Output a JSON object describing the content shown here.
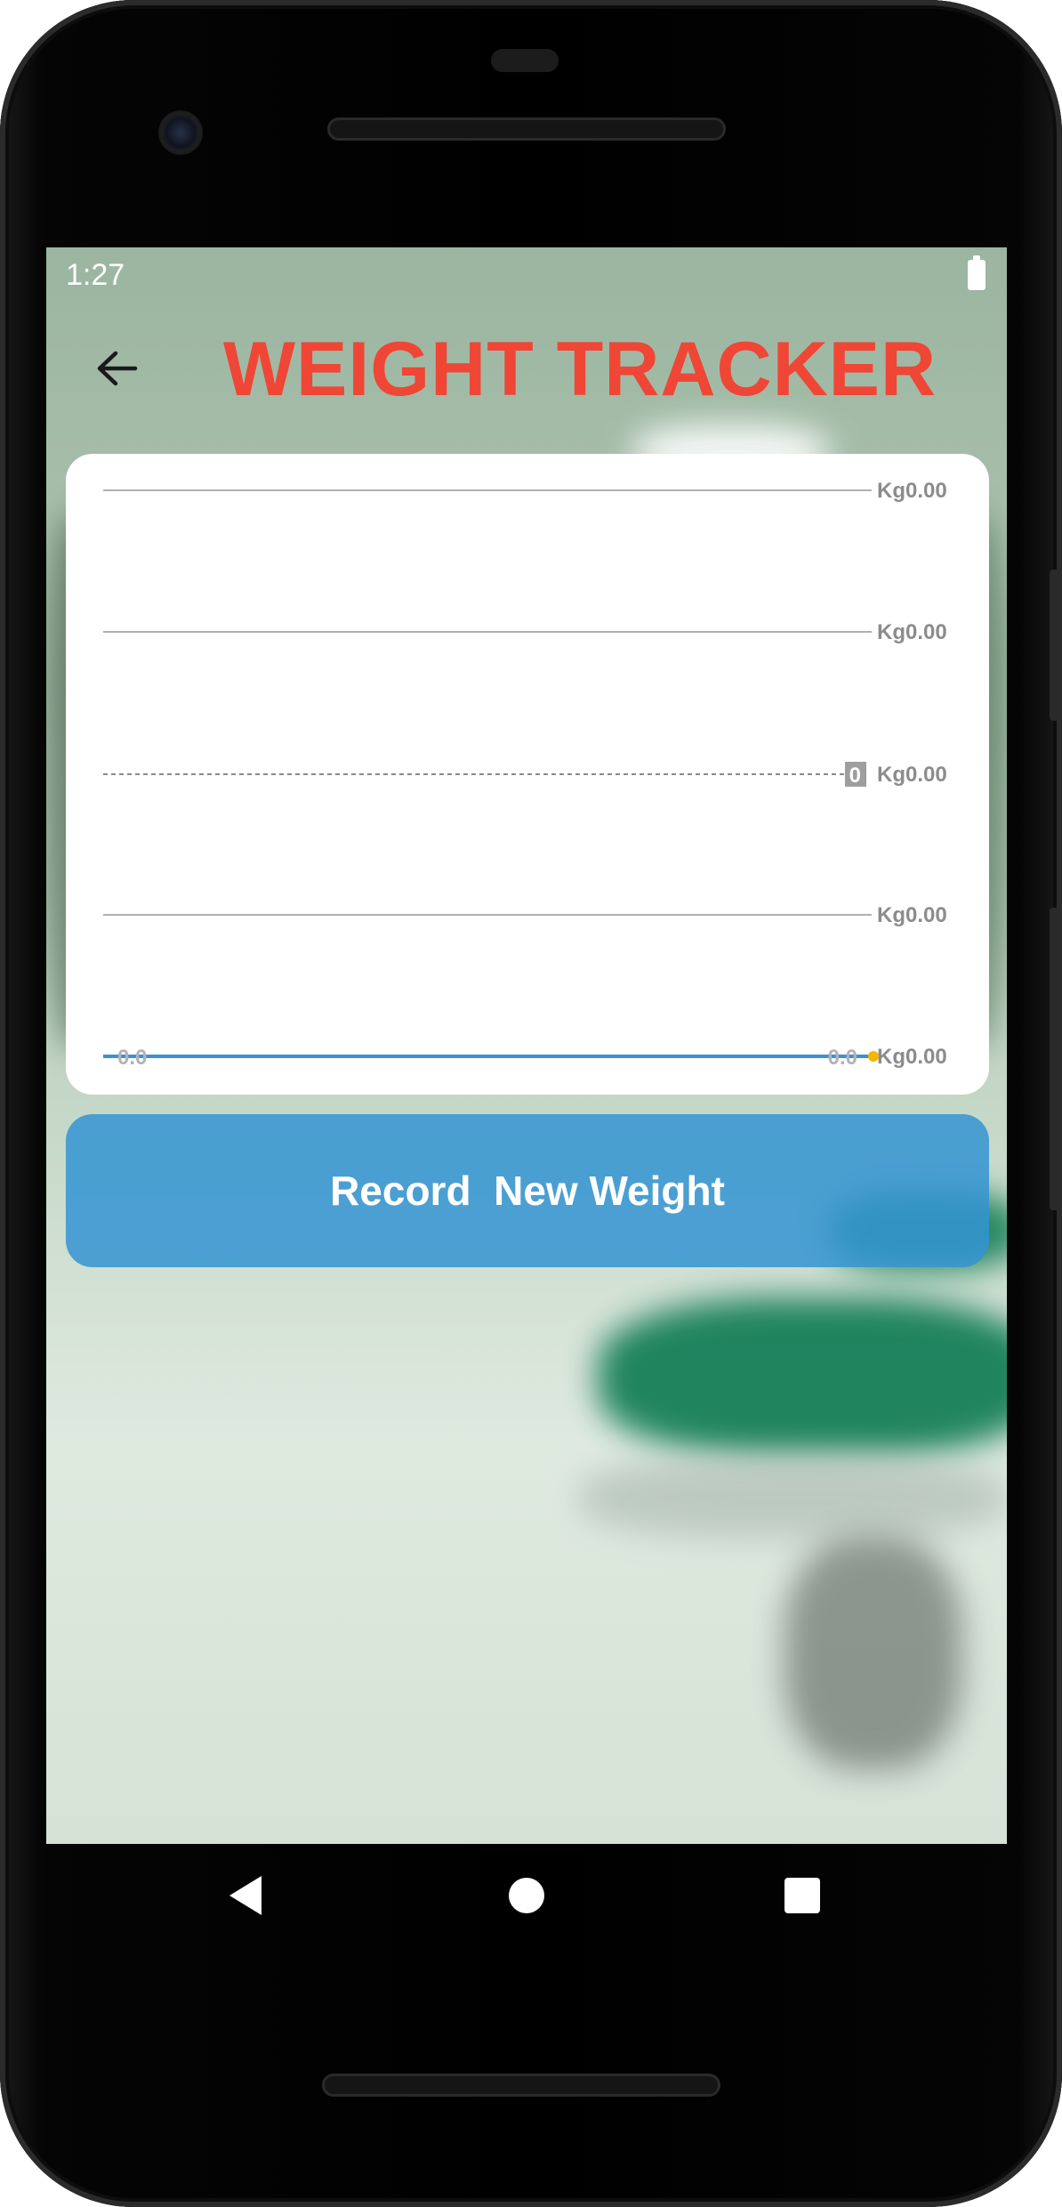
{
  "status_bar": {
    "time": "1:27",
    "battery_icon": "battery-full-icon"
  },
  "header": {
    "back_icon": "arrow-left-icon",
    "title": "WEIGHT TRACKER",
    "title_color": "#ef4636"
  },
  "chart_data": {
    "type": "line",
    "title": "",
    "xlabel": "",
    "ylabel": "",
    "y_tick_labels": [
      "Kg0.00",
      "Kg0.00",
      "Kg0.00",
      "Kg0.00",
      "Kg0.00"
    ],
    "limit_line_label": "0.0",
    "series": [
      {
        "values": [
          0.0,
          0.0
        ],
        "point_labels": [
          "0.0",
          "0.0"
        ],
        "color": "#3d8fd6"
      }
    ],
    "last_point_color": "#f2b705",
    "grid": true,
    "legend": false
  },
  "record_button": {
    "label": "Record  New Weight",
    "color": "#3494d2"
  },
  "nav_bar": {
    "back_icon": "nav-back-icon",
    "home_icon": "nav-home-icon",
    "recents_icon": "nav-recents-icon"
  }
}
